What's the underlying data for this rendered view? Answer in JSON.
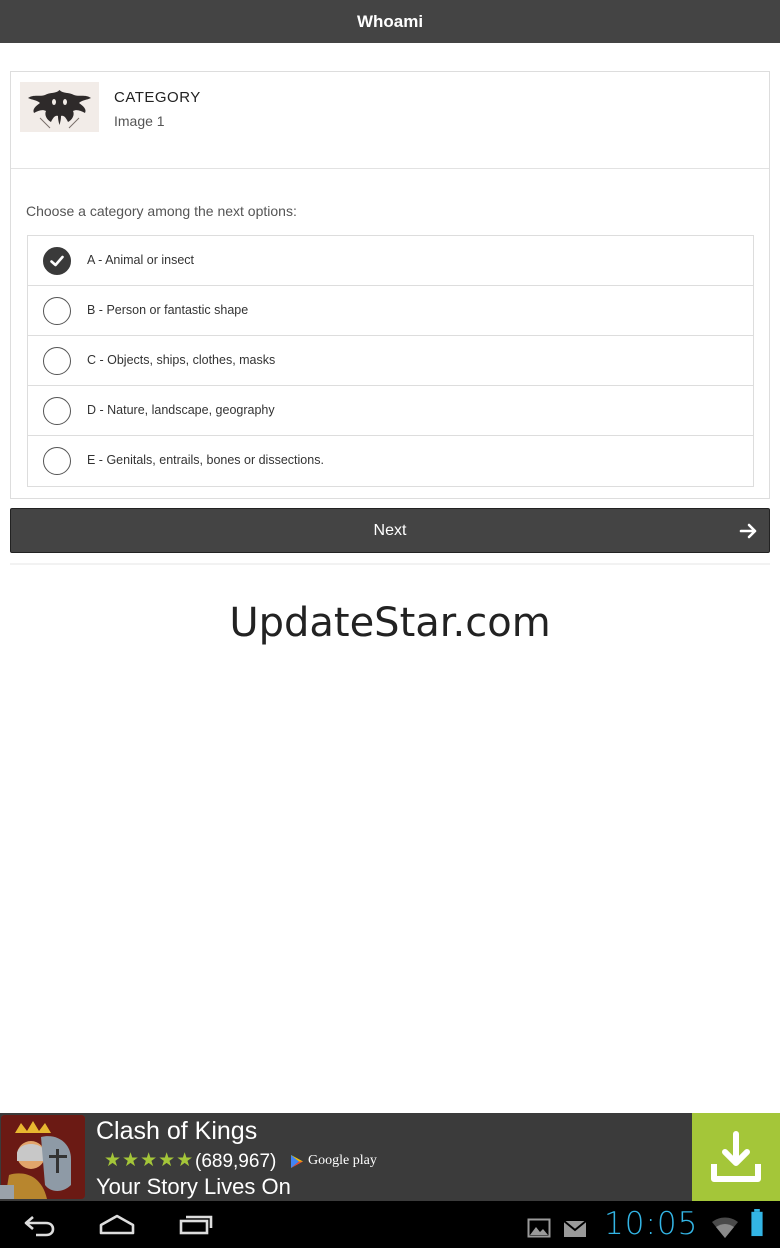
{
  "titlebar": {
    "title": "Whoami"
  },
  "card": {
    "category_title": "CATEGORY",
    "category_subtitle": "Image 1",
    "thumbnail": "inkblot-image",
    "prompt": "Choose a category among the next options:",
    "options": [
      {
        "label": "A - Animal or insect",
        "checked": true
      },
      {
        "label": "B - Person or fantastic shape",
        "checked": false
      },
      {
        "label": "C - Objects, ships, clothes, masks",
        "checked": false
      },
      {
        "label": "D - Nature, landscape, geography",
        "checked": false
      },
      {
        "label": "E - Genitals, entrails, bones or dissections.",
        "checked": false
      }
    ]
  },
  "next_button": {
    "label": "Next",
    "icon": "arrow-right-icon"
  },
  "watermark": {
    "text": "UpdateStar.com"
  },
  "ad": {
    "title": "Clash of Kings",
    "stars": "★★★★★",
    "rating_fraction": 0.9,
    "review_count": "(689,967)",
    "store": "Google play",
    "tagline": "Your Story Lives On",
    "icon": "knight-app-icon",
    "download_icon": "download-icon",
    "accent_color": "#a4c639"
  },
  "navbar": {
    "clock": "10:05",
    "clock_color": "#33b5e5",
    "icons": [
      "back-icon",
      "home-icon",
      "recent-apps-icon",
      "gallery-icon",
      "gmail-icon",
      "wifi-icon",
      "battery-icon"
    ]
  },
  "colors": {
    "header": "#444444",
    "background": "#ffffff",
    "border": "#dddddd"
  }
}
